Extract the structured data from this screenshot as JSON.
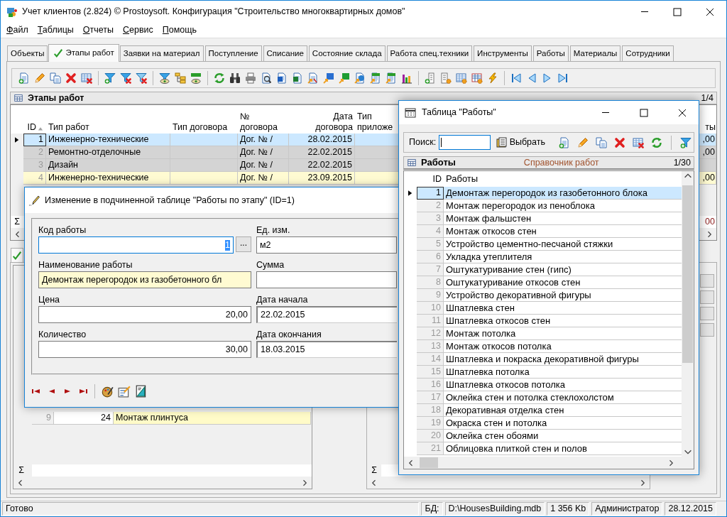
{
  "window": {
    "title": "Учет клиентов (2.824) © Prostoysoft. Конфигурация \"Строительство многоквартирных домов\""
  },
  "menu": [
    {
      "label": "Файл",
      "mnemonic": true
    },
    {
      "label": "Таблицы",
      "mnemonic": true
    },
    {
      "label": "Отчеты",
      "mnemonic": true
    },
    {
      "label": "Сервис",
      "mnemonic": true
    },
    {
      "label": "Помощь",
      "mnemonic": true
    }
  ],
  "tabs": [
    {
      "label": "Объекты",
      "selected": false,
      "checked": false
    },
    {
      "label": "Этапы работ",
      "selected": true,
      "checked": true
    },
    {
      "label": "Заявки на материал",
      "selected": false,
      "checked": false
    },
    {
      "label": "Поступление",
      "selected": false,
      "checked": false
    },
    {
      "label": "Списание",
      "selected": false,
      "checked": false
    },
    {
      "label": "Состояние склада",
      "selected": false,
      "checked": false
    },
    {
      "label": "Работа спец.техники",
      "selected": false,
      "checked": false
    },
    {
      "label": "Инструменты",
      "selected": false,
      "checked": false
    },
    {
      "label": "Работы",
      "selected": false,
      "checked": false
    },
    {
      "label": "Материалы",
      "selected": false,
      "checked": false
    },
    {
      "label": "Сотрудники",
      "selected": false,
      "checked": false
    }
  ],
  "stages": {
    "title": "Этапы работ",
    "counter": "1/4",
    "columns": [
      {
        "label": "ID",
        "sorted": true
      },
      {
        "label": "Тип работ",
        "sorted": false
      },
      {
        "label": "Тип договора",
        "sorted": false
      },
      {
        "label": "№ договора",
        "sorted": false
      },
      {
        "label": "Дата договора",
        "sorted": false
      },
      {
        "label": "Тип приложе",
        "sorted": false
      },
      {
        "label": "ты",
        "sorted": false
      }
    ],
    "rows": [
      {
        "id": "1",
        "work_type": "Инженерно-технические",
        "contract_no": "Дог. № /",
        "contract_date": "28.02.2015",
        "column_7": ",00",
        "selected": true,
        "color": "#cce8ff"
      },
      {
        "id": "2",
        "work_type": "Ремонтно-отделочные",
        "contract_no": "Дог. № /",
        "contract_date": "22.02.2015",
        "column_7": ",00",
        "selected": false,
        "color": "#d4d4d4"
      },
      {
        "id": "3",
        "work_type": "Дизайн",
        "contract_no": "Дог. № /",
        "contract_date": "22.02.2015",
        "selected": false,
        "color": "#d4d4d4"
      },
      {
        "id": "4",
        "work_type": "Инженерно-технические",
        "contract_no": "Дог. № /",
        "contract_date": "23.09.2015",
        "column_7": ",00",
        "selected": false,
        "color": "#fffbd2"
      }
    ],
    "sum_sign": "Σ",
    "total_column_7": "00"
  },
  "lower": {
    "tab_checked": true,
    "left_table": {
      "rows": [
        {
          "id": "9",
          "code": "24",
          "name": "Монтаж плинтуса",
          "color": "#fffbc8"
        }
      ],
      "sum_sign": "Σ"
    },
    "right_table": {
      "sum_sign": "Σ"
    }
  },
  "edit_dialog": {
    "title": "Изменение в подчиненной таблице \"Работы по этапу\" (ID=1)",
    "left_fields": [
      {
        "label": "Код работы",
        "value": "1",
        "kind": "lookup",
        "button_label": "...",
        "focused": true,
        "highlighted": false
      },
      {
        "label": "Наименование работы",
        "value": "Демонтаж перегородок из газобетонного бл",
        "kind": "text",
        "focused": false,
        "highlighted": true
      },
      {
        "label": "Цена",
        "value": "20,00",
        "kind": "number",
        "focused": false,
        "highlighted": false
      },
      {
        "label": "Количество",
        "value": "30,00",
        "kind": "number",
        "focused": false,
        "highlighted": false
      }
    ],
    "right_fields": [
      {
        "label": "Ед. изм.",
        "value": "м2",
        "kind": "text",
        "focused": false,
        "highlighted": false
      },
      {
        "label": "Сумма",
        "kind": "text",
        "focused": false,
        "highlighted": false
      },
      {
        "label": "Дата начала",
        "value": "22.02.2015",
        "kind": "date",
        "focused": false,
        "highlighted": false
      },
      {
        "label": "Дата окончания",
        "value": "18.03.2015",
        "kind": "date",
        "focused": false,
        "highlighted": false
      }
    ]
  },
  "works_window": {
    "title": "Таблица \"Работы\"",
    "search_label": "Поиск:",
    "search_focused": true,
    "select_button": "Выбрать",
    "panel_title": "Работы",
    "panel_subtitle": "Справочник работ",
    "counter": "1/30",
    "columns": [
      "ID",
      "Работы"
    ],
    "rows": [
      {
        "id": "1",
        "name": "Демонтаж перегородок из газобетонного блока",
        "selected": true
      },
      {
        "id": "2",
        "name": "Монтаж перегородок из пеноблока",
        "selected": false
      },
      {
        "id": "3",
        "name": "Монтаж фальшстен",
        "selected": false
      },
      {
        "id": "4",
        "name": "Монтаж откосов стен",
        "selected": false
      },
      {
        "id": "5",
        "name": "Устройство цементно-песчаной стяжки",
        "selected": false
      },
      {
        "id": "6",
        "name": "Укладка утеплителя",
        "selected": false
      },
      {
        "id": "7",
        "name": "Оштукатуривание стен (гипс)",
        "selected": false
      },
      {
        "id": "8",
        "name": "Оштукатуривание откосов стен",
        "selected": false
      },
      {
        "id": "9",
        "name": "Устройство декоративной фигуры",
        "selected": false
      },
      {
        "id": "10",
        "name": "Шпатлевка стен",
        "selected": false
      },
      {
        "id": "11",
        "name": "Шпатлевка откосов стен",
        "selected": false
      },
      {
        "id": "12",
        "name": "Монтаж потолка",
        "selected": false
      },
      {
        "id": "13",
        "name": "Монтаж откосов потолка",
        "selected": false
      },
      {
        "id": "14",
        "name": "Шпатлевка и покраска декоративной фигуры",
        "selected": false
      },
      {
        "id": "15",
        "name": "Шпатлевка потолка",
        "selected": false
      },
      {
        "id": "16",
        "name": "Шпатлевка откосов потолка",
        "selected": false
      },
      {
        "id": "17",
        "name": "Оклейка стен и потолка стеклохолстом",
        "selected": false
      },
      {
        "id": "18",
        "name": "Декоративная отделка стен",
        "selected": false
      },
      {
        "id": "19",
        "name": "Окраска стен и потолка",
        "selected": false
      },
      {
        "id": "20",
        "name": "Оклейка стен обоями",
        "selected": false
      },
      {
        "id": "21",
        "name": "Облицовка плиткой  стен и полов",
        "selected": false
      }
    ]
  },
  "status_bar": {
    "message": "Готово",
    "db_label": "БД:",
    "db_path": "D:\\HousesBuilding.mdb",
    "db_size": "1 356 Kb",
    "user": "Администратор",
    "date": "28.12.2015"
  }
}
